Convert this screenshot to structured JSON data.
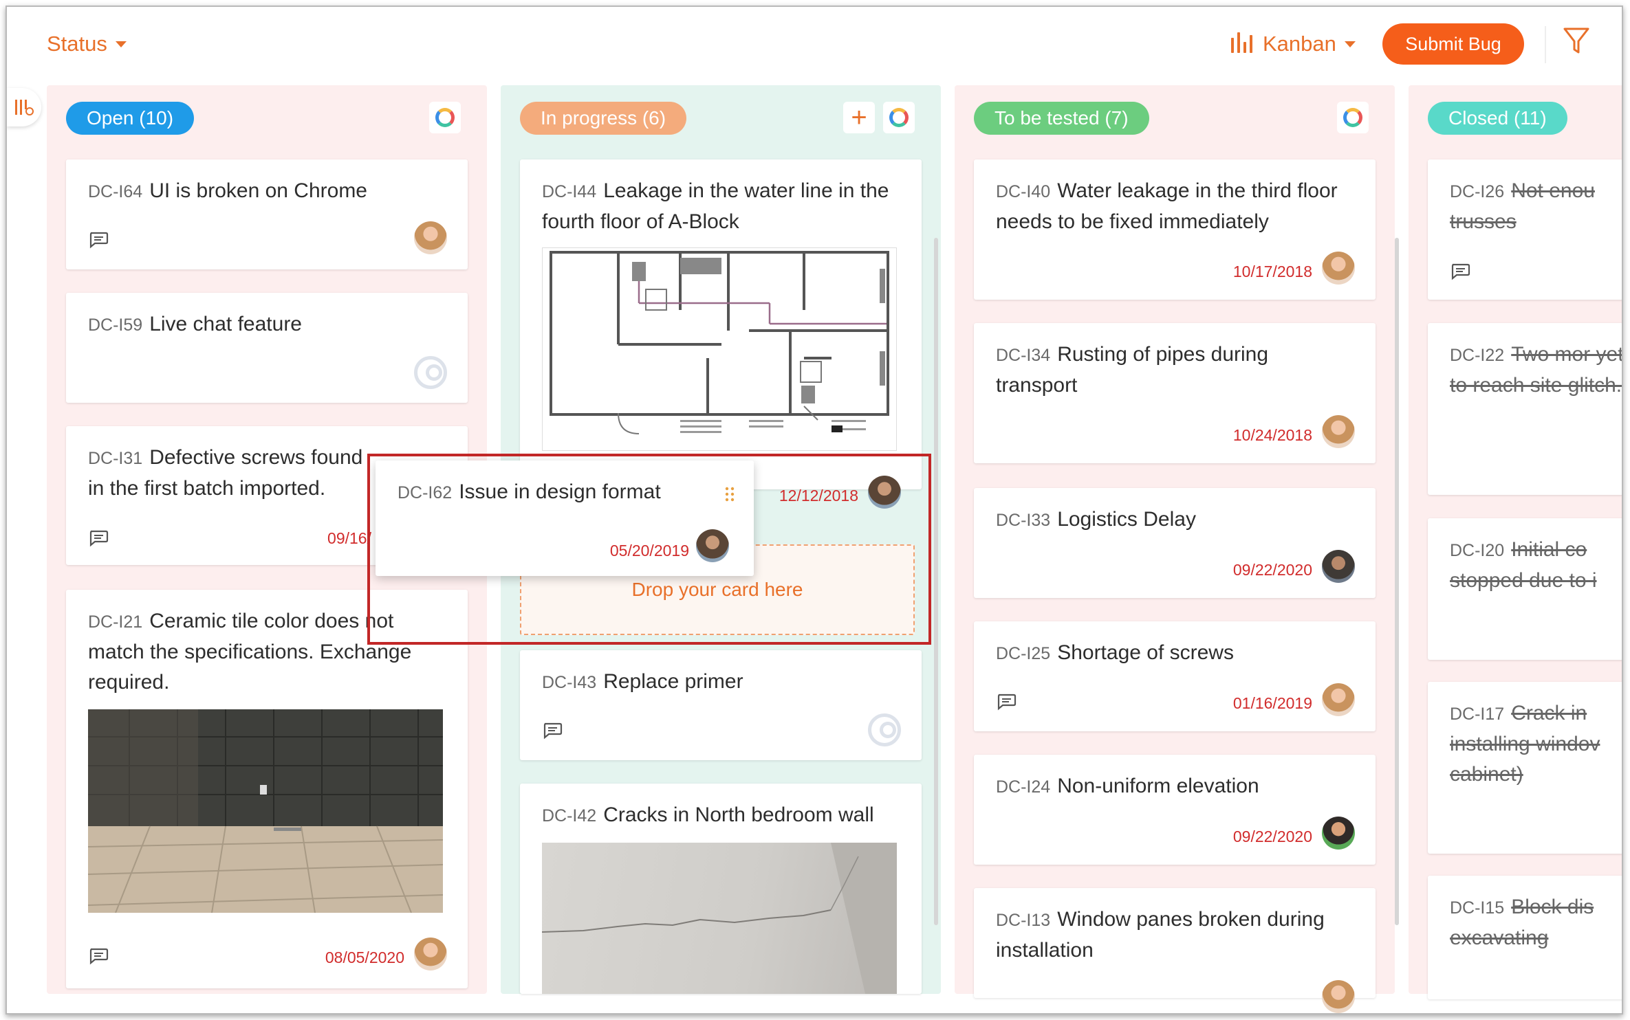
{
  "header": {
    "status_label": "Status",
    "view_label": "Kanban",
    "submit_label": "Submit Bug"
  },
  "icons": [
    "columns-icon",
    "kanban-icon",
    "filter-icon",
    "comment-icon",
    "plus-icon",
    "refresh-ring-icon",
    "drag-handle-icon"
  ],
  "colors": {
    "accent": "#e8702a",
    "submit": "#f55e1a",
    "overdue": "#d12c2c",
    "open": "#1f9be8",
    "in_progress": "#f4ab7c",
    "to_be_tested": "#6ccd7f",
    "closed": "#59d9c9"
  },
  "columns": {
    "open": {
      "label": "Open (10)",
      "cards": [
        {
          "id": "DC-I64",
          "title": "UI is broken on Chrome",
          "date": ""
        },
        {
          "id": "DC-I59",
          "title": "Live chat feature",
          "date": ""
        },
        {
          "id": "DC-I31",
          "title": "Defective screws found in the first batch imported.",
          "date": "09/16/"
        },
        {
          "id": "DC-I21",
          "title": "Ceramic tile color does not match the specifications. Exchange required.",
          "date": "08/05/2020"
        }
      ]
    },
    "in_progress": {
      "label": "In progress (6)",
      "cards": [
        {
          "id": "DC-I44",
          "title": "Leakage in the water line in the fourth floor of A-Block",
          "date": "12/12/2018"
        },
        {
          "id": "DC-I43",
          "title": "Replace primer",
          "date": ""
        },
        {
          "id": "DC-I42",
          "title": "Cracks in North bedroom wall",
          "date": ""
        }
      ],
      "dropzone_label": "Drop your card here"
    },
    "to_be_tested": {
      "label": "To be tested (7)",
      "cards": [
        {
          "id": "DC-I40",
          "title": "Water leakage in the third floor needs to be fixed immediately",
          "date": "10/17/2018"
        },
        {
          "id": "DC-I34",
          "title": "Rusting of pipes during transport",
          "date": "10/24/2018"
        },
        {
          "id": "DC-I33",
          "title": "Logistics Delay",
          "date": "09/22/2020"
        },
        {
          "id": "DC-I25",
          "title": "Shortage of screws",
          "date": "01/16/2019"
        },
        {
          "id": "DC-I24",
          "title": "Non-uniform elevation",
          "date": "09/22/2020"
        },
        {
          "id": "DC-I13",
          "title": "Window panes broken during installation",
          "date": ""
        }
      ]
    },
    "closed": {
      "label": "Closed (11)",
      "cards": [
        {
          "id": "DC-I26",
          "title": "Not enou trusses"
        },
        {
          "id": "DC-I22",
          "title": "Two mor yet to reach site glitch."
        },
        {
          "id": "DC-I20",
          "title": "Initial co stopped due to i"
        },
        {
          "id": "DC-I17",
          "title": "Crack in installing windov cabinet)"
        },
        {
          "id": "DC-I15",
          "title": "Block dis excavating"
        }
      ]
    }
  },
  "dragging_card": {
    "id": "DC-I62",
    "title": "Issue in design format",
    "date": "05/20/2019"
  }
}
